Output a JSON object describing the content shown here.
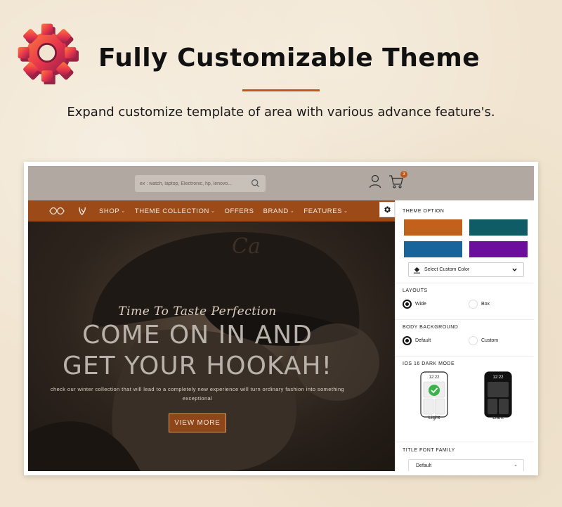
{
  "promo": {
    "headline": "Fully Customizable Theme",
    "subline": "Expand customize template of area with various advance feature's."
  },
  "header": {
    "search_placeholder": "ex : watch, laptop, Electronic, hp, lenovo...",
    "cart_count": "3"
  },
  "nav": {
    "items": [
      {
        "label": "SHOP",
        "dropdown": true
      },
      {
        "label": "THEME COLLECTION",
        "dropdown": true
      },
      {
        "label": "OFFERS",
        "dropdown": false
      },
      {
        "label": "BRAND",
        "dropdown": true
      },
      {
        "label": "FEATURES",
        "dropdown": true
      }
    ]
  },
  "hero": {
    "script": "Time To Taste Perfection",
    "title_line1": "COME ON IN AND",
    "title_line2": "GET YOUR HOOKAH!",
    "description": "check our winter collection that will lead to a completely new experience will turn ordinary fashion into something exceptional",
    "button": "VIEW MORE"
  },
  "panel": {
    "theme_option_label": "THEME OPTION",
    "swatches": [
      "#c2611c",
      "#0f5c66",
      "#17659a",
      "#6c0f9c"
    ],
    "select_color_label": "Select Custom Color",
    "layouts_label": "LAYOUTS",
    "layouts": [
      {
        "label": "Wide",
        "selected": true
      },
      {
        "label": "Box",
        "selected": false
      }
    ],
    "body_bg_label": "BODY BACKGROUND",
    "body_bg": [
      {
        "label": "Default",
        "selected": true
      },
      {
        "label": "Custom",
        "selected": false
      }
    ],
    "dark_mode_label": "IOS 16 DARK MODE",
    "watch_light": {
      "time": "12:22",
      "caption": "Light"
    },
    "watch_dark": {
      "time": "12:22",
      "caption": "Dark"
    },
    "font_label": "TITLE FONT FAMILY",
    "font_value": "Default"
  },
  "colors": {
    "accent": "#c0581b",
    "nav_bg": "#9b4a18",
    "header_bg": "#b1a9a1",
    "check_green": "#3cb24a"
  }
}
